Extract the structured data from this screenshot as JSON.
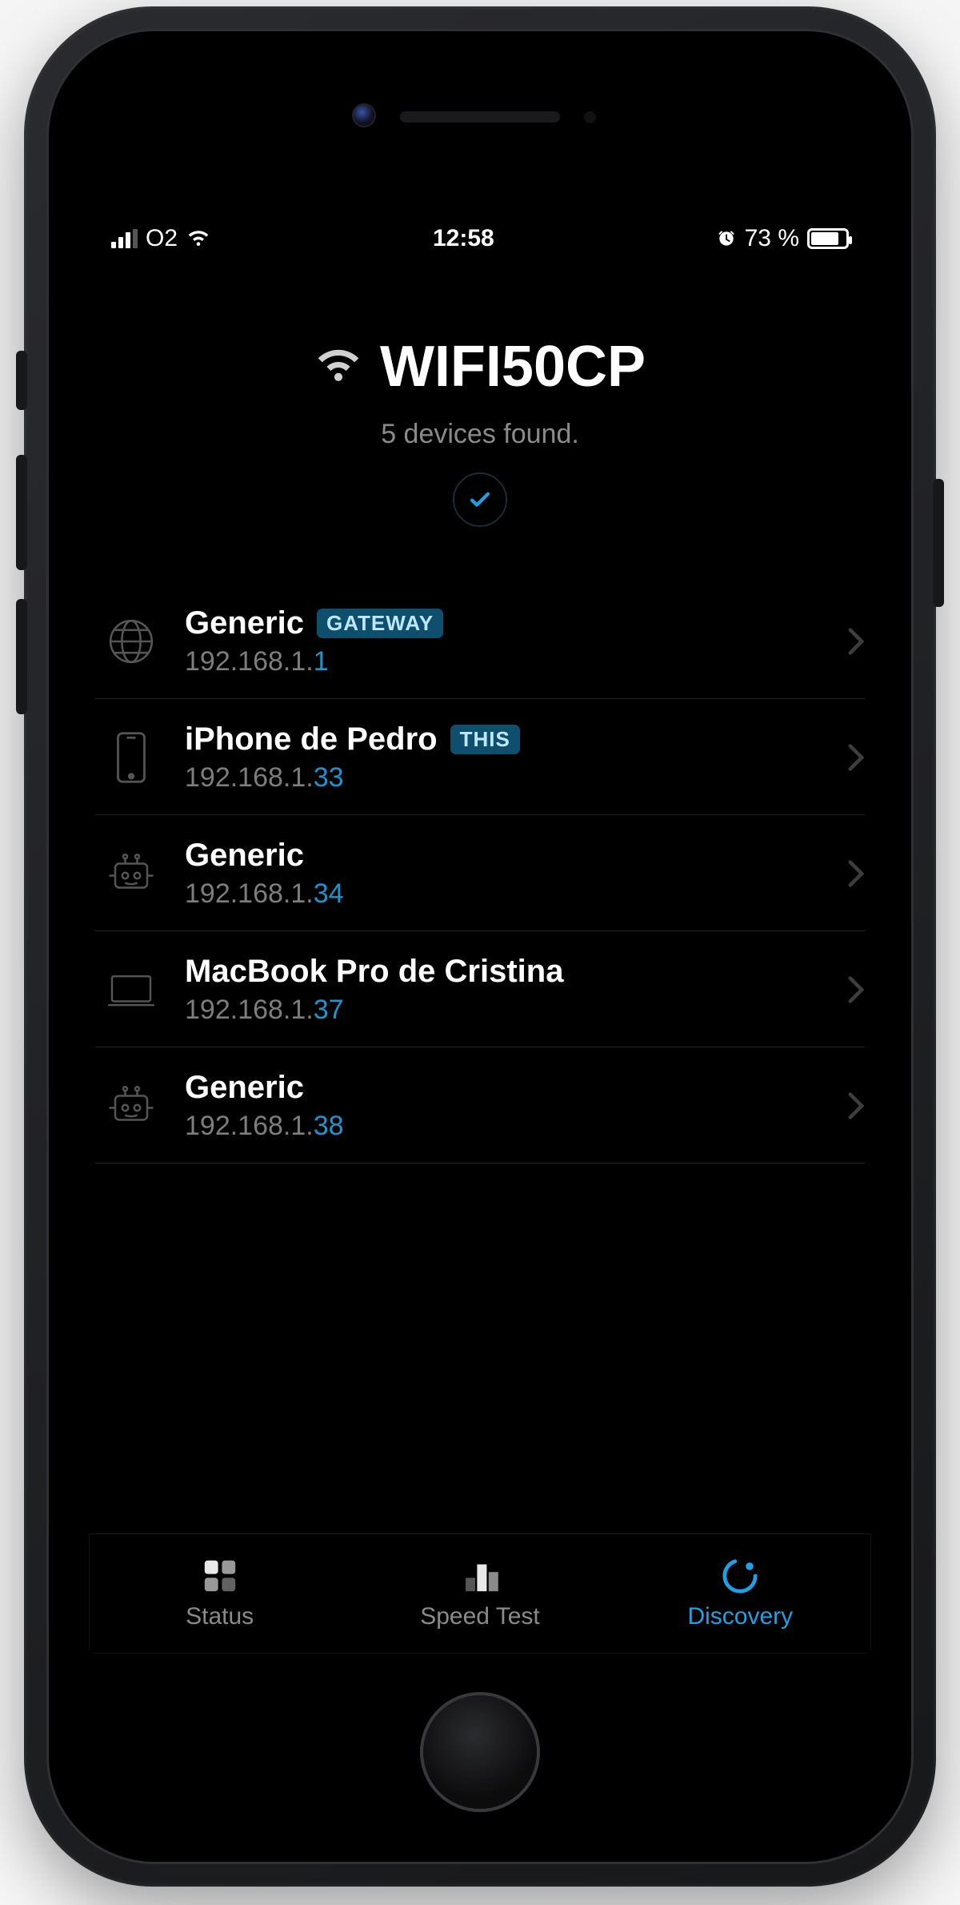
{
  "status_bar": {
    "carrier": "O2",
    "time": "12:58",
    "battery_text": "73 %"
  },
  "header": {
    "network_name": "WIFI50CP",
    "devices_found": "5 devices found."
  },
  "badges": {
    "gateway": "GATEWAY",
    "this": "THIS"
  },
  "devices": [
    {
      "name": "Generic",
      "ip_prefix": "192.168.1.",
      "ip_host": "1",
      "icon": "globe",
      "badge": "gateway"
    },
    {
      "name": "iPhone de Pedro",
      "ip_prefix": "192.168.1.",
      "ip_host": "33",
      "icon": "phone",
      "badge": "this"
    },
    {
      "name": "Generic",
      "ip_prefix": "192.168.1.",
      "ip_host": "34",
      "icon": "robot",
      "badge": null
    },
    {
      "name": "MacBook Pro de Cristina",
      "ip_prefix": "192.168.1.",
      "ip_host": "37",
      "icon": "laptop",
      "badge": null
    },
    {
      "name": "Generic",
      "ip_prefix": "192.168.1.",
      "ip_host": "38",
      "icon": "robot",
      "badge": null
    }
  ],
  "tabs": {
    "status": "Status",
    "speed_test": "Speed Test",
    "discovery": "Discovery"
  }
}
